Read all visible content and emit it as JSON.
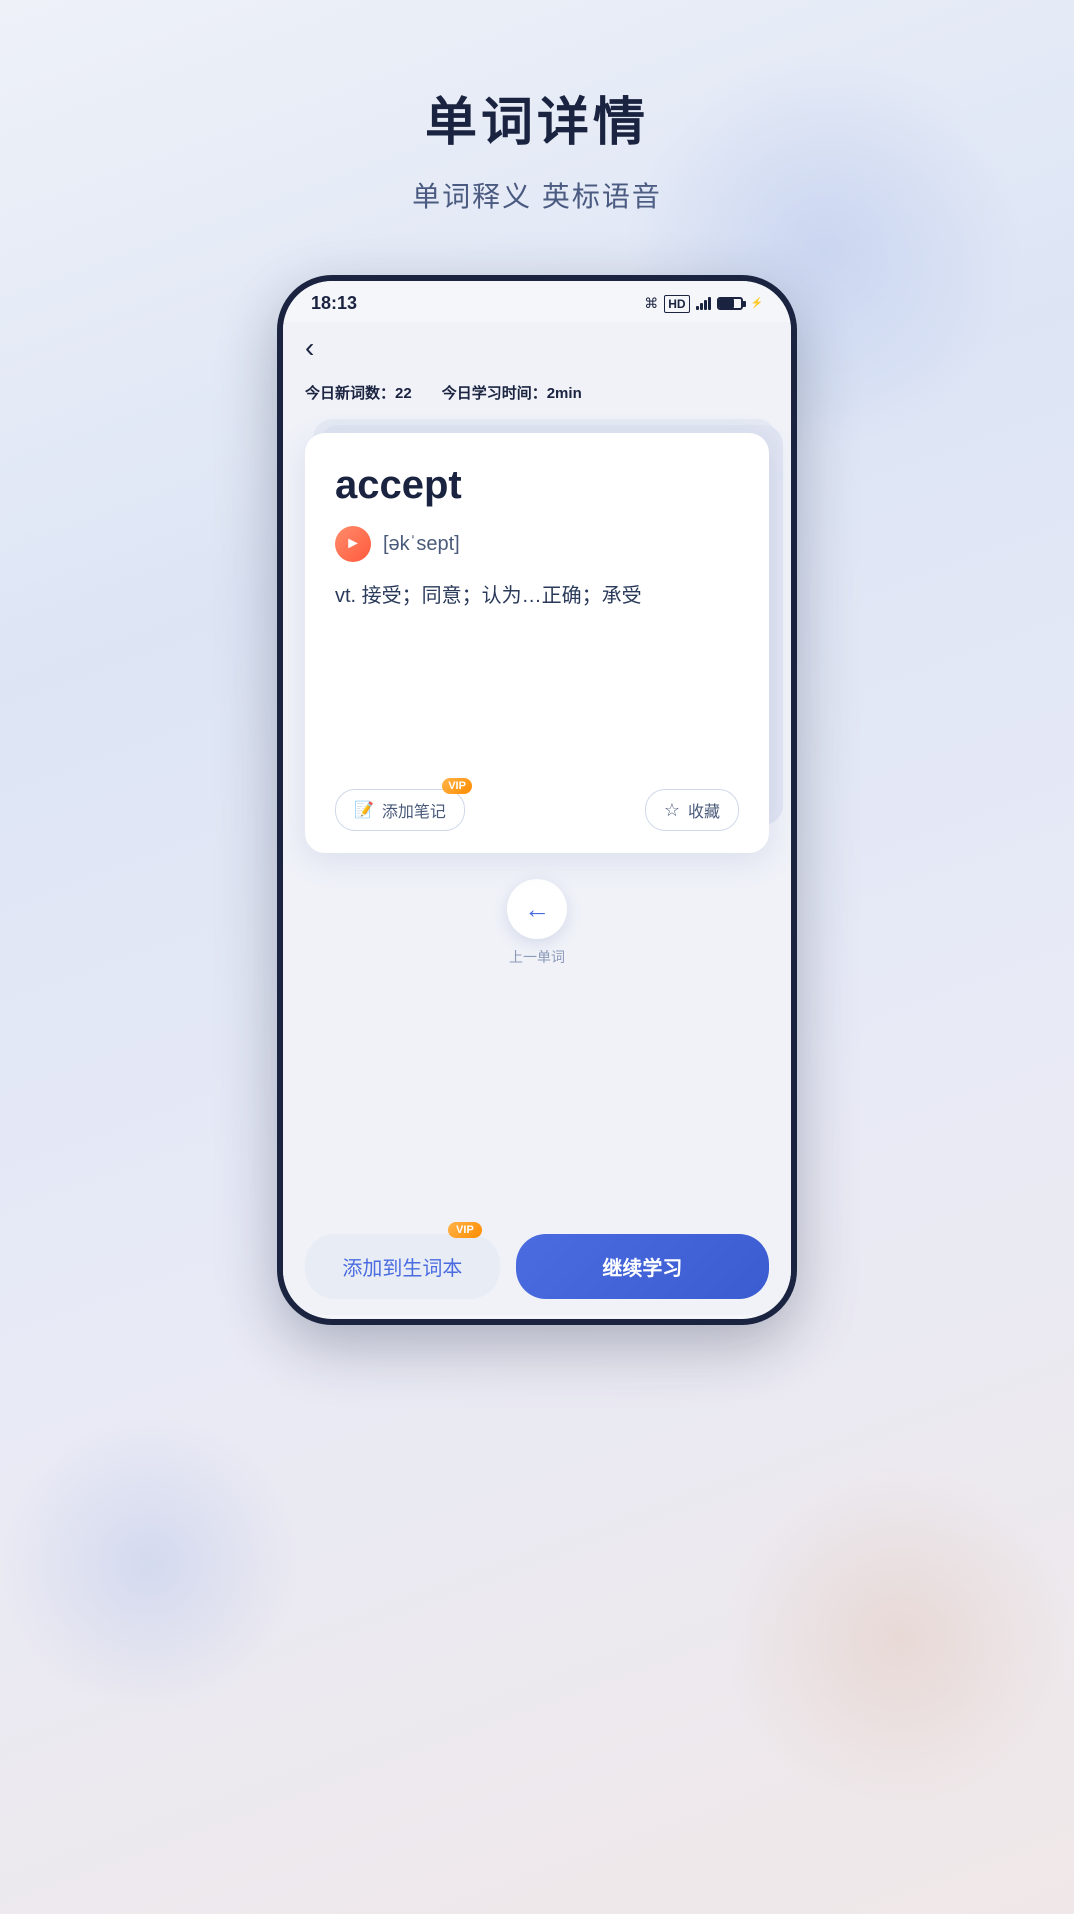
{
  "page": {
    "title": "单词详情",
    "subtitle": "单词释义 英标语音"
  },
  "status_bar": {
    "time": "18:13",
    "hd_label": "HD"
  },
  "phone": {
    "back_arrow": "‹",
    "stats": {
      "new_words_label": "今日新词数：",
      "new_words_value": "22",
      "study_time_label": "今日学习时间：",
      "study_time_value": "2min"
    },
    "word_card": {
      "word": "accept",
      "phonetic": "[əkˈsept]",
      "definition": "vt. 接受；同意；认为…正确；承受",
      "add_note_label": "添加笔记",
      "collect_label": "收藏",
      "vip_label": "VIP"
    },
    "navigation": {
      "prev_arrow": "←",
      "prev_label": "上一单词"
    },
    "bottom_buttons": {
      "add_to_vocab": "添加到生词本",
      "continue_learning": "继续学习",
      "vip_label": "VIP"
    }
  }
}
